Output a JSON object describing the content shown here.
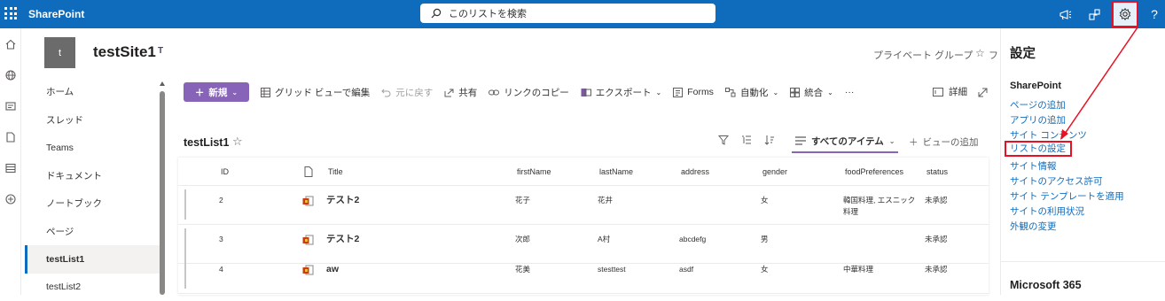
{
  "topbar": {
    "brand": "SharePoint",
    "search_placeholder": "このリストを検索",
    "icons": [
      "app-launcher-icon",
      "megaphone-icon",
      "share-icon",
      "settings-gear-icon",
      "help-icon"
    ],
    "help_label": "?",
    "accent": "#0f6cbd"
  },
  "site": {
    "logo_letter": "t",
    "title": "testSite1",
    "teams_glyph": "T",
    "privacy": "プライベート グループ",
    "follow_fragment": "フ"
  },
  "nav": {
    "items": [
      {
        "label": "ホーム"
      },
      {
        "label": "スレッド"
      },
      {
        "label": "Teams"
      },
      {
        "label": "ドキュメント"
      },
      {
        "label": "ノートブック"
      },
      {
        "label": "ページ"
      },
      {
        "label": "testList1"
      },
      {
        "label": "testList2"
      }
    ],
    "active": "testList1"
  },
  "commands": {
    "new": "新規",
    "grid": "グリッド ビューで編集",
    "undo": "元に戻す",
    "share": "共有",
    "copy_link": "リンクのコピー",
    "export": "エクスポート",
    "forms": "Forms",
    "automate": "自動化",
    "integrate": "統合",
    "more": "···",
    "details": "詳細"
  },
  "list": {
    "title": "testList1",
    "view": "すべてのアイテム",
    "add_view": "ビューの追加",
    "columns": [
      "ID",
      "Title",
      "firstName",
      "lastName",
      "address",
      "gender",
      "foodPreferences",
      "status"
    ],
    "rows": [
      {
        "id": "2",
        "title": "テスト2",
        "firstName": "花子",
        "lastName": "花井",
        "address": "",
        "gender": "女",
        "food1": "韓国料理, エスニック",
        "food2": "料理",
        "status": "未承認"
      },
      {
        "id": "3",
        "title": "テスト2",
        "firstName": "次郎",
        "lastName": "A村",
        "address": "abcdefg",
        "gender": "男",
        "food1": "",
        "food2": "",
        "status": "未承認"
      },
      {
        "id": "4",
        "title": "aw",
        "firstName": "花美",
        "lastName": "stesttest",
        "address": "asdf",
        "gender": "女",
        "food1": "中華料理",
        "food2": "",
        "status": "未承認"
      }
    ]
  },
  "settings_panel": {
    "heading": "設定",
    "section": "SharePoint",
    "links": [
      "ページの追加",
      "アプリの追加",
      "サイト コンテンツ",
      "リストの設定",
      "サイト情報",
      "サイトのアクセス許可",
      "サイト テンプレートを適用",
      "サイトの利用状況",
      "外観の変更"
    ],
    "highlighted": "リストの設定",
    "footer_section": "Microsoft 365",
    "highlight_color": "#e81123"
  }
}
